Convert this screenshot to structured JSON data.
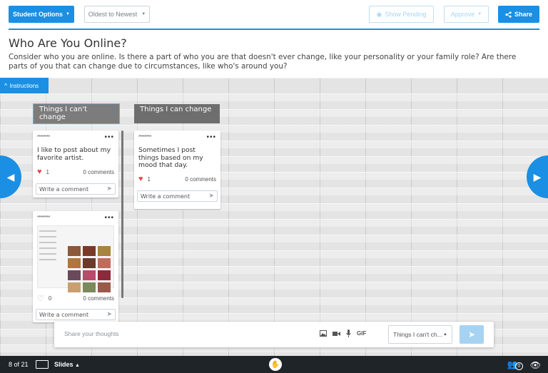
{
  "toolbar": {
    "student_options": "Student Options",
    "sort": "Oldest to Newest",
    "show_pending": "Show Pending",
    "approve": "Approve",
    "share": "Share"
  },
  "header": {
    "title": "Who Are You Online?",
    "description": "Consider who you are online. Is there a part of who you are that doesn't ever change, like your personality or your family role? Are there parts of you that can change due to circumstances, like who's around you?"
  },
  "instructions_label": "Instructions",
  "columns": [
    {
      "title": "Things I can't change",
      "cards": [
        {
          "author": "********",
          "text": "I like to post about my favorite artist.",
          "likes": "1",
          "comments": "0 comments",
          "comment_placeholder": "Write a comment"
        },
        {
          "author": "********",
          "text": "",
          "likes": "0",
          "comments": "0 comments",
          "comment_placeholder": "Write a comment"
        }
      ]
    },
    {
      "title": "Things I can change",
      "cards": [
        {
          "author": "********",
          "text": "Sometimes I post things based on my mood that day.",
          "likes": "1",
          "comments": "0 comments",
          "comment_placeholder": "Write a comment"
        }
      ]
    }
  ],
  "composer": {
    "placeholder": "Share your thoughts",
    "gif_label": "GIF",
    "column_select": "Things I can't ch..."
  },
  "bottom": {
    "page": "8 of 21",
    "slides": "Slides",
    "participants": "0"
  },
  "colors": {
    "accent": "#1a8fe3",
    "bottom_bar": "#1f2429"
  }
}
